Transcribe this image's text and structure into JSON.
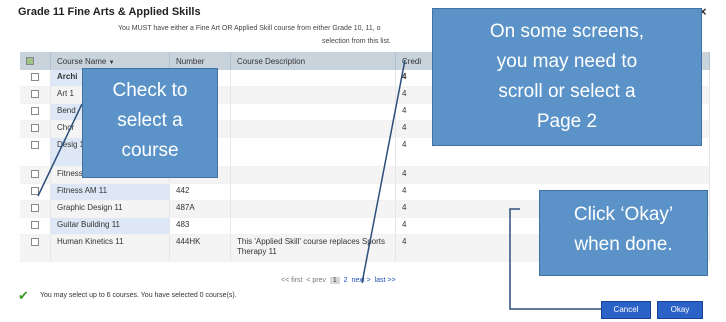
{
  "dialog": {
    "title": "Grade 11 Fine Arts & Applied Skills",
    "close_glyph": "×",
    "notice_line1": "You MUST have either a Fine Art OR Applied Skill course from either Grade 10, 11, o",
    "notice_line2": "selection from this list."
  },
  "table": {
    "headers": [
      "",
      "Course Name",
      "Number",
      "Course Description",
      "Credi"
    ],
    "rows": [
      {
        "name": "Archi",
        "number": "",
        "desc": "",
        "credits": "4"
      },
      {
        "name": "Art 1",
        "number": "",
        "desc": "",
        "credits": "4"
      },
      {
        "name": "Bend",
        "number": "",
        "desc": "",
        "credits": "4"
      },
      {
        "name": "Chor",
        "number": "",
        "desc": "",
        "credits": "4"
      },
      {
        "name": "Desig 11",
        "number": "",
        "desc": "",
        "credits": "4"
      },
      {
        "name": "Fitness 11",
        "number": "443",
        "desc": "",
        "credits": "4"
      },
      {
        "name": "Fitness AM 11",
        "number": "442",
        "desc": "",
        "credits": "4"
      },
      {
        "name": "Graphic Design 11",
        "number": "487A",
        "desc": "",
        "credits": "4"
      },
      {
        "name": "Guitar Building 11",
        "number": "483",
        "desc": "",
        "credits": "4"
      },
      {
        "name": "Human Kinetics 11",
        "number": "444HK",
        "desc": "This 'Applied Skill' course replaces Sports Therapy 11",
        "credits": "4"
      }
    ]
  },
  "pager": {
    "first": "<< first",
    "prev": "< prev",
    "page1": "1",
    "page2": "2",
    "next": "next >",
    "last": "last >>"
  },
  "status": {
    "message": "You may select up to 6 courses.  You have selected 0 course(s)."
  },
  "buttons": {
    "cancel": "Cancel",
    "okay": "Okay"
  },
  "callouts": {
    "check": [
      "Check to",
      "select a",
      "course"
    ],
    "scroll": [
      "On some screens,",
      "you may need to",
      "scroll or select a",
      "Page 2"
    ],
    "okay": [
      "Click ‘Okay’",
      "when done."
    ]
  },
  "colors": {
    "callout_bg": "#5b93c9",
    "header_bg": "#c9d3dc",
    "button_bg": "#2a62c7",
    "check_green": "#3a9a2a"
  },
  "icons": {
    "select_all": "checkbox-icon",
    "status": "checkmark-icon"
  }
}
